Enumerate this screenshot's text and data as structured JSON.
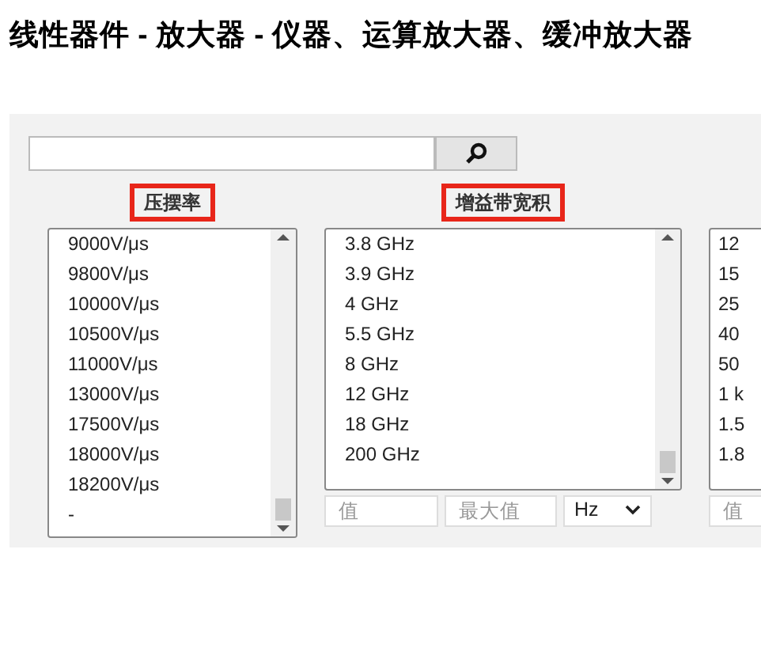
{
  "page_title": "线性器件 - 放大器 - 仪器、运算放大器、缓冲放大器",
  "filters": [
    {
      "label": "压摆率",
      "items": [
        "9000V/μs",
        "9800V/μs",
        "10000V/μs",
        "10500V/μs",
        "11000V/μs",
        "13000V/μs",
        "17500V/μs",
        "18000V/μs",
        "18200V/μs",
        "-"
      ]
    },
    {
      "label": "增益带宽积",
      "items": [
        "3.8 GHz",
        "3.9 GHz",
        "4 GHz",
        "5.5 GHz",
        "8 GHz",
        "12 GHz",
        "18 GHz",
        "200 GHz"
      ],
      "min_placeholder": "值",
      "max_placeholder": "最大值",
      "unit": "Hz"
    },
    {
      "items": [
        "12",
        "15",
        "25",
        "40",
        "50",
        "1 k",
        "1.5",
        "1.8"
      ],
      "min_placeholder": "值"
    }
  ]
}
